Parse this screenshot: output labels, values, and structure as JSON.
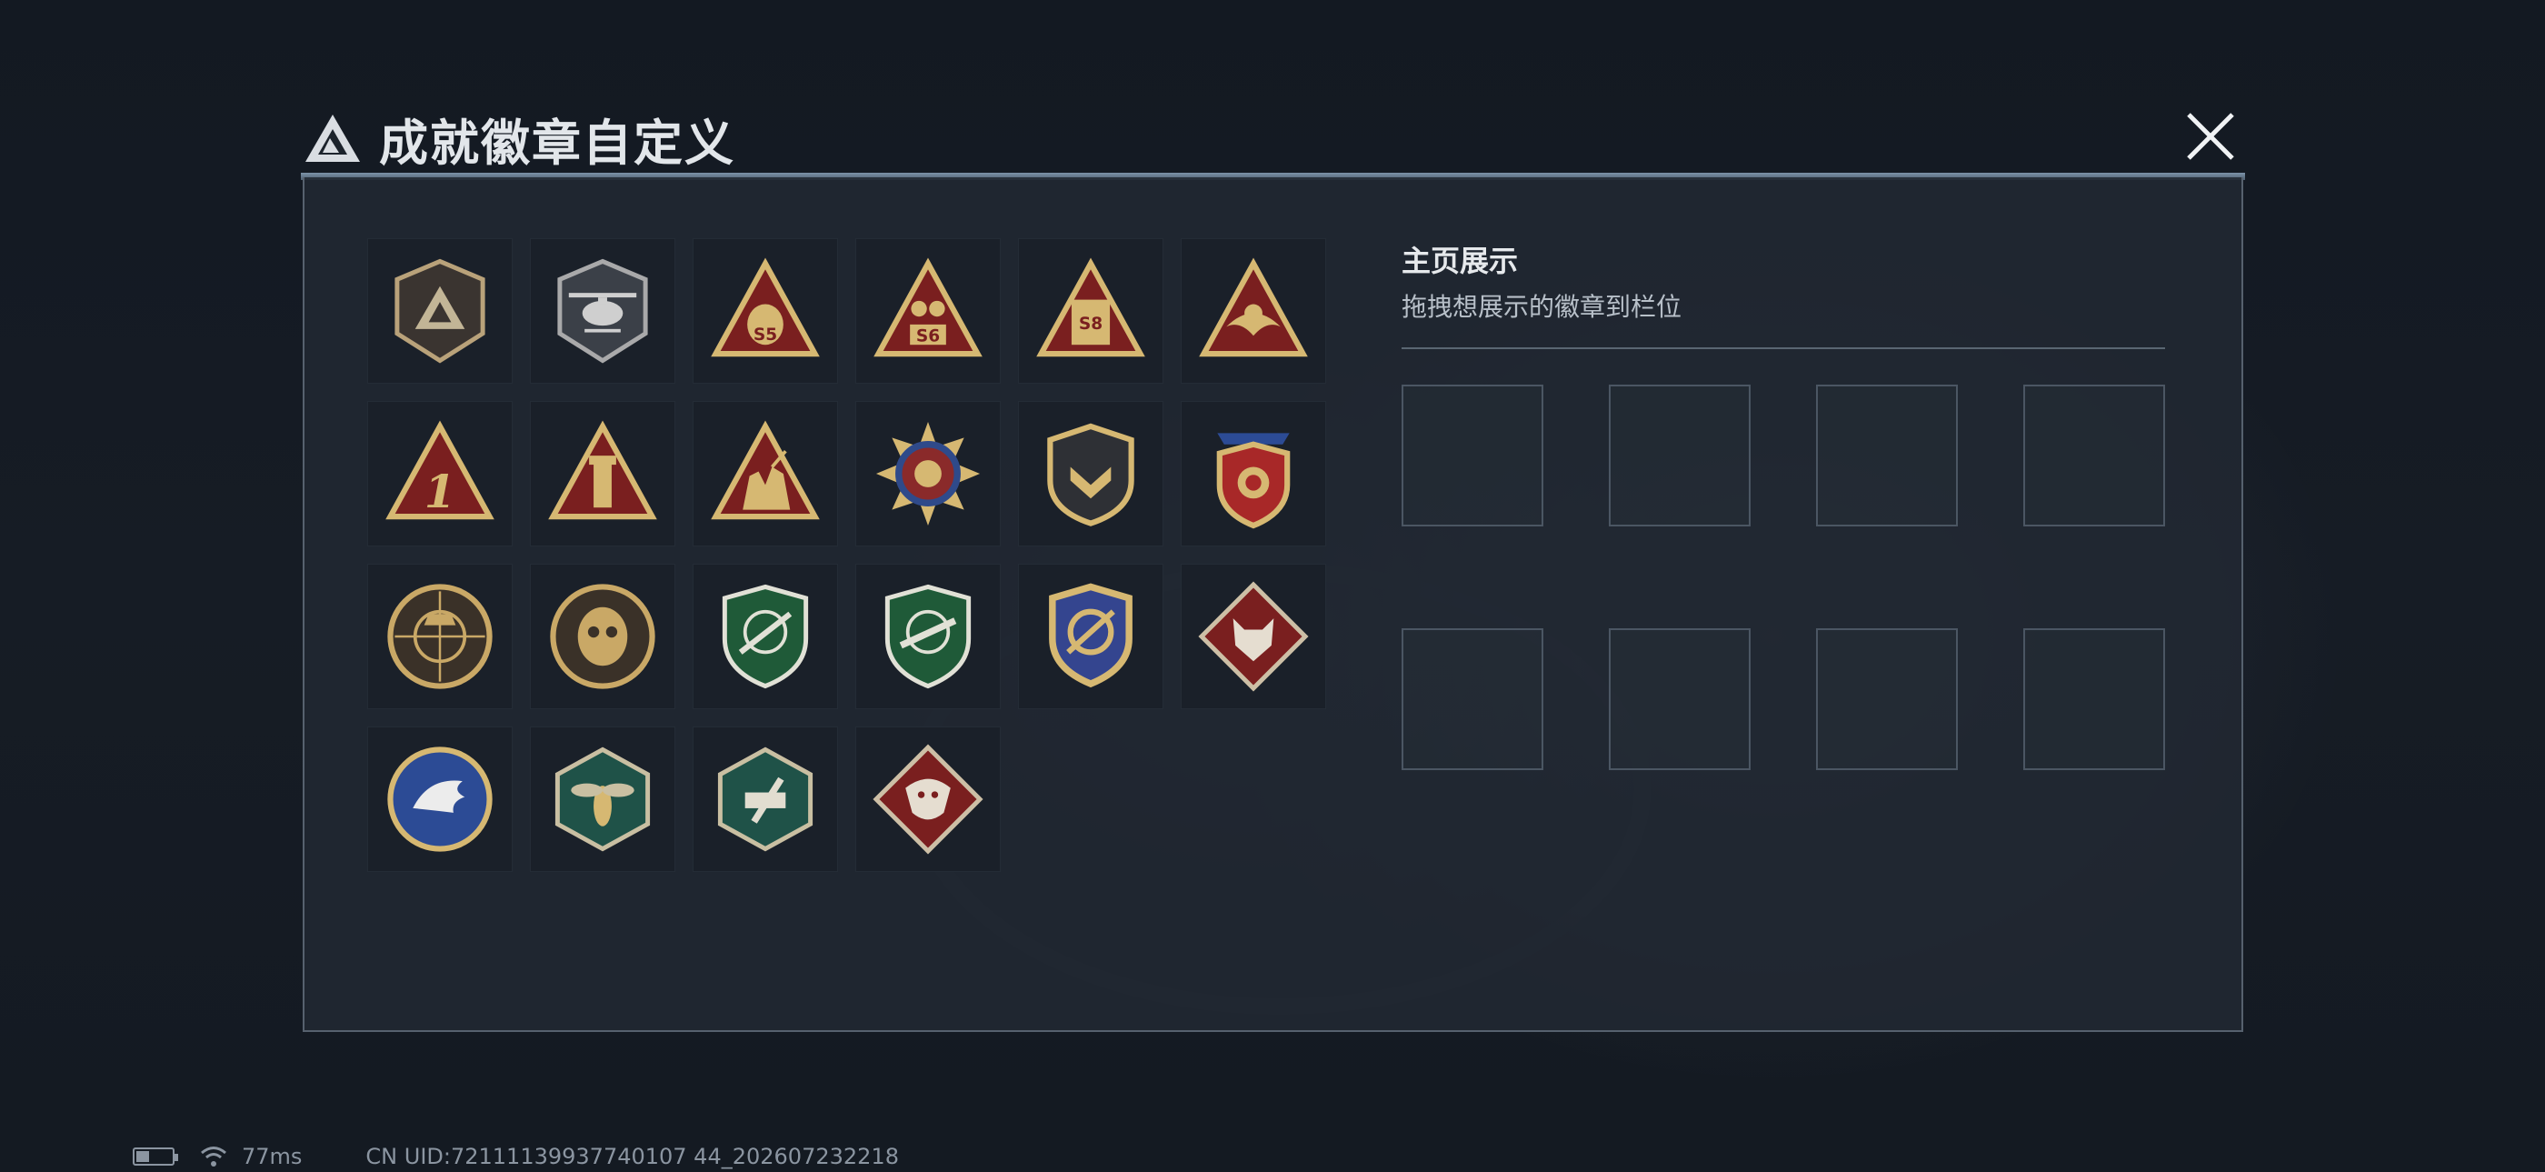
{
  "window": {
    "title": "成就徽章自定义",
    "title_small_print": "                ",
    "close_icon": "close-icon"
  },
  "badges": [
    {
      "name": "delta-shield-badge",
      "icon": "delta-logo-icon"
    },
    {
      "name": "helicopter-shield-badge",
      "icon": "helicopter-icon"
    },
    {
      "name": "s5-season-badge",
      "label": "S5"
    },
    {
      "name": "s6-season-badge",
      "label": "S6"
    },
    {
      "name": "s8-season-badge",
      "label": "S8"
    },
    {
      "name": "eagle-triangle-badge",
      "icon": "eagle-icon"
    },
    {
      "name": "rank-one-badge",
      "label": "1"
    },
    {
      "name": "tower-triangle-badge",
      "icon": "tower-icon"
    },
    {
      "name": "soldiers-triangle-badge",
      "icon": "soldiers-icon"
    },
    {
      "name": "star-medal-badge",
      "icon": "star-medal-icon"
    },
    {
      "name": "dark-shield-badge",
      "icon": "chevron-shield-icon"
    },
    {
      "name": "royal-shield-badge",
      "icon": "crest-icon"
    },
    {
      "name": "sniper-circle-badge",
      "icon": "sniper-icon"
    },
    {
      "name": "masked-circle-badge",
      "icon": "mask-icon"
    },
    {
      "name": "green-sniper-shield-badge",
      "icon": "rifle-icon"
    },
    {
      "name": "green-rifle-shield-badge",
      "icon": "rifle-icon"
    },
    {
      "name": "gold-blue-shield-badge",
      "icon": "crosshair-icon"
    },
    {
      "name": "wolf-diamond-badge",
      "icon": "wolf-icon"
    },
    {
      "name": "eagle-circle-badge",
      "icon": "eagle-icon"
    },
    {
      "name": "wasp-hexagon-badge",
      "icon": "wasp-icon"
    },
    {
      "name": "tool-hexagon-badge",
      "icon": "tool-icon"
    },
    {
      "name": "dragon-diamond-badge",
      "icon": "dragon-icon"
    }
  ],
  "showcase": {
    "title": "主页展示",
    "subtitle": "拖拽想展示的徽章到栏位",
    "slots": 8
  },
  "status": {
    "ping": "77ms",
    "uid": "CN UID:72111139937740107 44_202607232218"
  },
  "colors": {
    "background": "#141a22",
    "panel": "#212832",
    "gold": "#c9a866",
    "red": "#7a1f1f",
    "green": "#1f5a38"
  }
}
